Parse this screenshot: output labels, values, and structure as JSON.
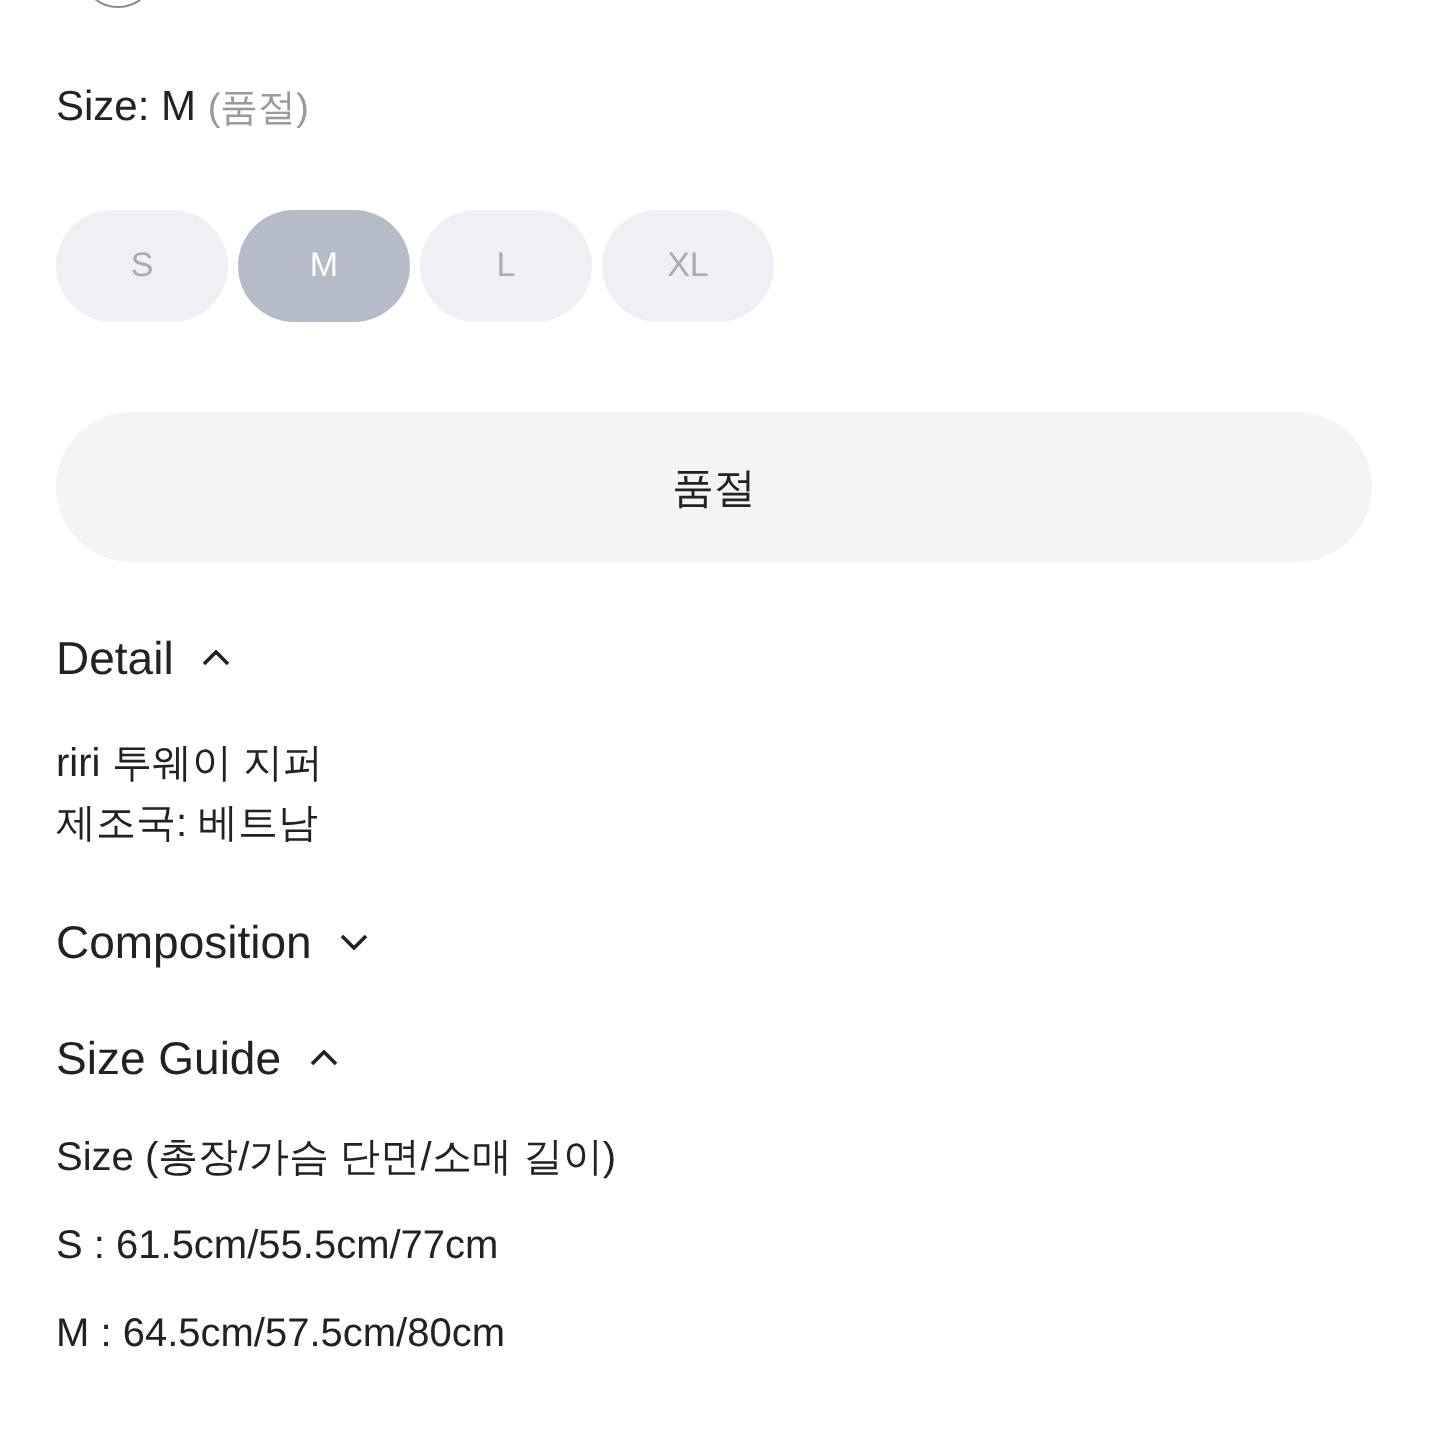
{
  "swatch": {
    "selected": true
  },
  "size_label": {
    "text": "Size: M",
    "note": "(품절)"
  },
  "sizes": [
    {
      "label": "S",
      "selected": false
    },
    {
      "label": "M",
      "selected": true
    },
    {
      "label": "L",
      "selected": false
    },
    {
      "label": "XL",
      "selected": false
    }
  ],
  "action_button": {
    "label": "품절"
  },
  "sections": [
    {
      "title": "Detail",
      "expanded": true,
      "lines": [
        "riri 투웨이 지퍼",
        "제조국: 베트남"
      ],
      "kind": "block"
    },
    {
      "title": "Composition",
      "expanded": false,
      "kind": "block"
    },
    {
      "title": "Size Guide",
      "expanded": true,
      "lines": [
        "Size (총장/가슴 단면/소매 길이)",
        "S : 61.5cm/55.5cm/77cm",
        "M : 64.5cm/57.5cm/80cm"
      ],
      "kind": "list"
    }
  ]
}
